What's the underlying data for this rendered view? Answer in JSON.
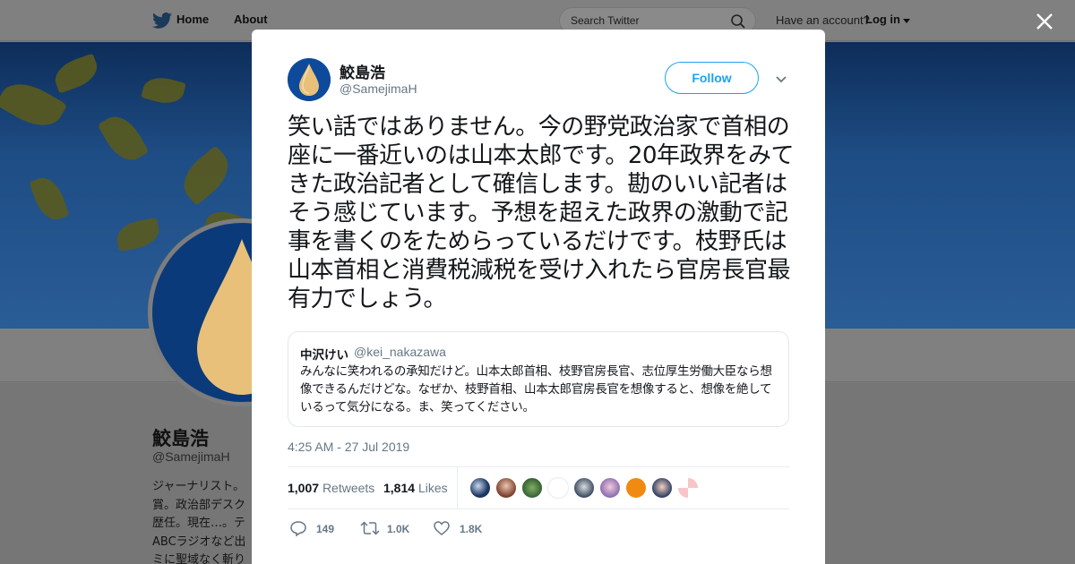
{
  "nav": {
    "home": "Home",
    "about": "About",
    "search_placeholder": "Search Twitter",
    "have_account": "Have an account?",
    "login": "Log in"
  },
  "profile": {
    "name": "鮫島浩",
    "handle": "@SamejimaH",
    "bio": "ジャーナリスト。\n賞。政治部デスク\n歴任。現在…。テ\nABCラジオなど出\nミに聖域なく斬り"
  },
  "tweet": {
    "author_name": "鮫島浩",
    "author_handle": "@SamejimaH",
    "follow_label": "Follow",
    "text": "笑い話ではありません。今の野党政治家で首相の座に一番近いのは山本太郎です。20年政界をみてきた政治記者として確信します。勘のいい記者はそう感じています。予想を超えた政界の激動で記事を書くのをためらっているだけです。枝野氏は山本首相と消費税減税を受け入れたら官房長官最有力でしょう。",
    "timestamp": "4:25 AM - 27 Jul 2019",
    "retweets_count": "1,007",
    "retweets_label": "Retweets",
    "likes_count": "1,814",
    "likes_label": "Likes",
    "reply_count": "149",
    "retweet_action_count": "1.0K",
    "like_action_count": "1.8K"
  },
  "quoted": {
    "name": "中沢けい",
    "handle": "@kei_nakazawa",
    "text": "みんなに笑われるの承知だけど。山本太郎首相、枝野官房長官、志位厚生労働大臣なら想像できるんだけどな。なぜか、枝野首相、山本太郎官房長官を想像すると、想像を絶しているって気分になる。ま、笑ってください。"
  },
  "colors": {
    "accent": "#1da1f2",
    "secondary_text": "#657786",
    "primary_text": "#14171a",
    "avatar_blue": "#0d4a9c",
    "avatar_drop": "#e8c07a"
  },
  "icons": [
    "twitter-bird-icon",
    "search-icon",
    "close-icon",
    "chevron-down-icon",
    "reply-icon",
    "retweet-icon",
    "heart-icon"
  ]
}
